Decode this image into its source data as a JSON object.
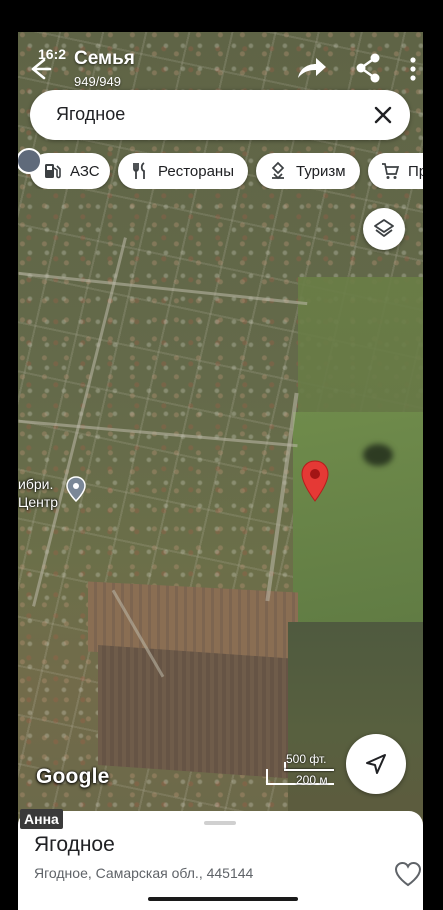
{
  "status": {
    "time": "16:2"
  },
  "header": {
    "title": "Семья",
    "subtitle": "949/949"
  },
  "search": {
    "value": "Ягодное"
  },
  "chips": [
    {
      "label": "АЗС",
      "icon": "gas-station-icon"
    },
    {
      "label": "Рестораны",
      "icon": "restaurant-icon"
    },
    {
      "label": "Туризм",
      "icon": "tourism-icon"
    },
    {
      "label": "Пр",
      "icon": "shopping-cart-icon"
    }
  ],
  "map": {
    "poi_label_line1": "ибри.",
    "poi_label_line2": "Центр",
    "logo_text": "Google",
    "scale_ft": "500 фт.",
    "scale_m": "200 м",
    "marker_color": "#e53935"
  },
  "sheet": {
    "user_name": "Анна",
    "title": "Ягодное",
    "address": "Ягодное, Самарская обл., 445144"
  },
  "colors": {
    "accent_red": "#e53935",
    "sheet_bg": "#ffffff"
  }
}
